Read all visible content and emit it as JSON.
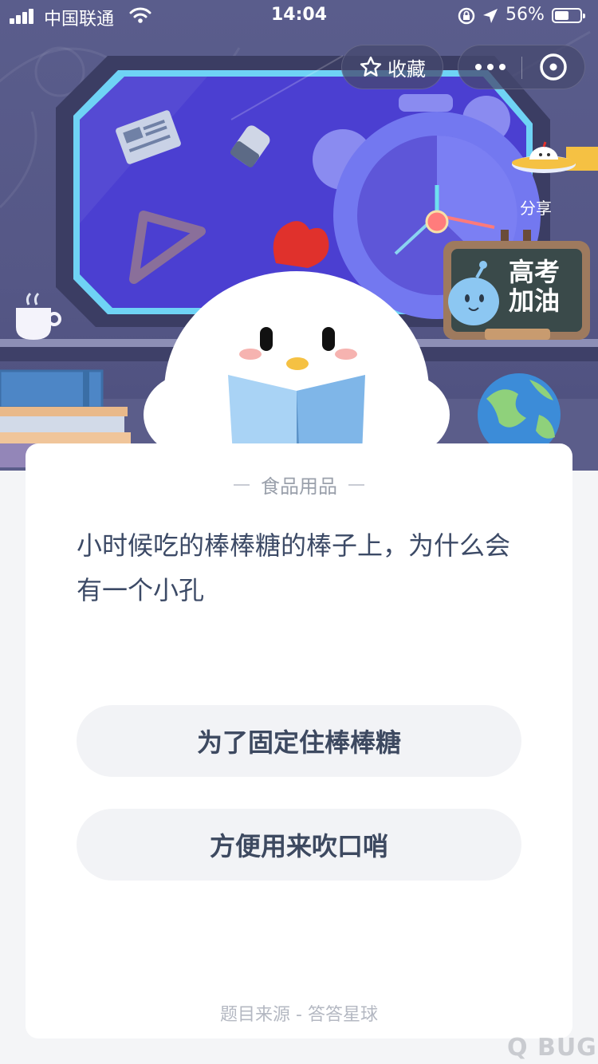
{
  "status_bar": {
    "carrier": "中国联通",
    "time": "14:04",
    "battery_percent": "56%",
    "battery_level": 0.56
  },
  "top_actions": {
    "favorite_label": "收藏",
    "favorite_icon": "star-icon",
    "more_icon": "more-dots-icon",
    "close_icon": "close-target-icon"
  },
  "scene": {
    "share_label": "分享",
    "board_text_line1": "高考",
    "board_text_line2": "加油"
  },
  "quiz": {
    "category": "食品用品",
    "question": "小时候吃的棒棒糖的棒子上，为什么会有一个小孔",
    "options": [
      "为了固定住棒棒糖",
      "方便用来吹口哨"
    ],
    "source": "题目来源 - 答答星球"
  },
  "watermark": "Q BUG",
  "colors": {
    "hero_bg": "#585a89",
    "window_blue": "#4a3fd0",
    "card_bg": "#ffffff",
    "option_bg": "#f2f3f6",
    "question_text": "#3c4a66"
  }
}
